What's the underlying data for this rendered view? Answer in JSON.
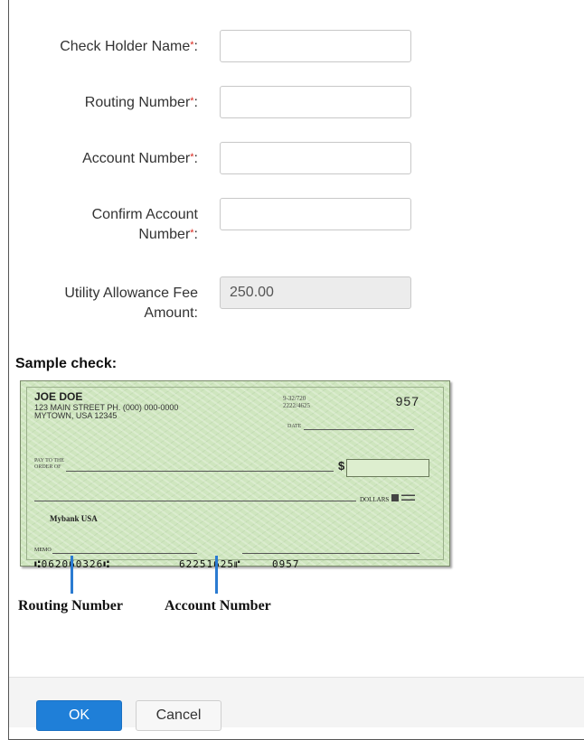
{
  "form": {
    "holder_name": {
      "label": "Check Holder Name",
      "required_mark": "*",
      "suffix": ":",
      "value": ""
    },
    "routing_number": {
      "label": "Routing Number",
      "required_mark": "*",
      "suffix": ":",
      "value": ""
    },
    "account_number": {
      "label": "Account Number",
      "required_mark": "*",
      "suffix": ":",
      "value": ""
    },
    "confirm_account": {
      "label_line1": "Confirm Account",
      "label_line2": "Number",
      "required_mark": "*",
      "suffix": ":",
      "value": ""
    },
    "utility_fee": {
      "label_line1": "Utility Allowance Fee",
      "label_line2": "Amount:",
      "value": "250.00"
    }
  },
  "sample": {
    "heading": "Sample check:",
    "check": {
      "name": "JOE DOE",
      "address_line1": "123 MAIN STREET  PH. (000) 000-0000",
      "address_line2": "MYTOWN, USA 12345",
      "fraction_top": "9-32/720",
      "fraction_bottom": "2222/4625",
      "check_number": "957",
      "date_label": "DATE",
      "pay_to_line1": "PAY TO THE",
      "pay_to_line2": "ORDER OF",
      "dollar_sign": "$",
      "dollars_word": "DOLLARS",
      "bank_name": "Mybank USA",
      "memo_label": "MEMO",
      "micr_routing": "⑆062060326⑆",
      "micr_account": "62251625⑈",
      "micr_check": "0957"
    },
    "caption_routing": "Routing Number",
    "caption_account": "Account Number"
  },
  "footer": {
    "ok_label": "OK",
    "cancel_label": "Cancel"
  },
  "colors": {
    "required": "#d9261c",
    "primary_button": "#1f7fd8",
    "pointer": "#2b7bd1",
    "check_background": "#cfe6bf"
  }
}
